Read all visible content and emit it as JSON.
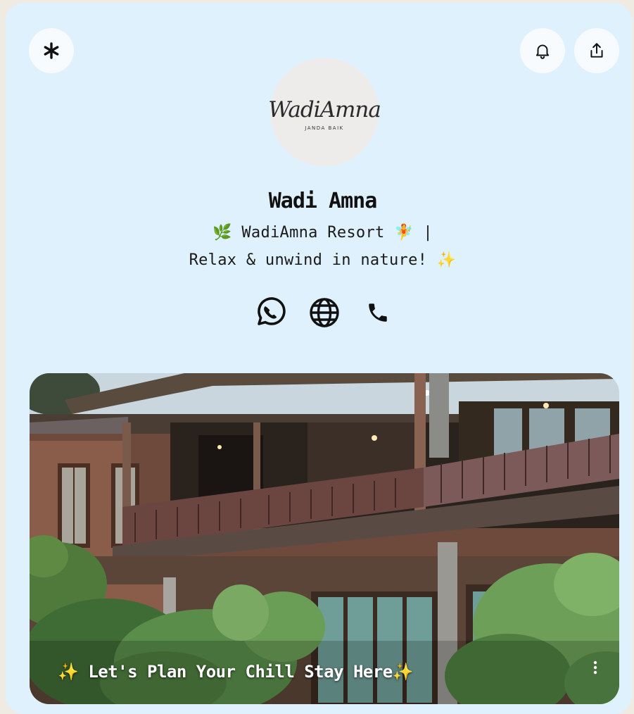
{
  "profile": {
    "logo_script": "WadiAmna",
    "logo_sub": "JANDA BAIK",
    "name": "Wadi Amna",
    "bio_line1": "🌿 WadiAmna Resort 🧚 |",
    "bio_line2": "Relax & unwind in nature! ✨"
  },
  "top_bar": {
    "left_icon": "asterisk-icon",
    "right_icons": [
      "bell-icon",
      "share-icon"
    ]
  },
  "social_icons": [
    "whatsapp-icon",
    "globe-icon",
    "phone-icon"
  ],
  "link_card": {
    "label": "✨ Let's Plan Your Chill Stay Here✨",
    "image": "resort-building-photo",
    "menu_icon": "kebab-menu-icon"
  },
  "colors": {
    "background": "#dff1fc",
    "button_bg": "#f7fbfd",
    "text": "#111111"
  }
}
